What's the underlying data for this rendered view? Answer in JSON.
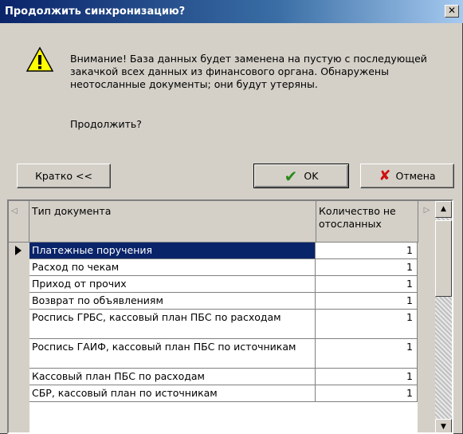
{
  "dialog": {
    "title": "Продолжить синхронизацию?",
    "close_glyph": "✕",
    "message": "Внимание! База данных будет заменена на пустую с последующей закачкой всех данных из финансового органа. Обнаружены неотосланные документы; они будут утеряны.",
    "question": "Продолжить?"
  },
  "buttons": {
    "short": "Кратко <<",
    "ok": "OK",
    "cancel": "Отмена"
  },
  "table": {
    "columns": [
      "Тип документа",
      "Количество не отосланных"
    ],
    "rows": [
      {
        "type": "Платежные поручения",
        "count": "1"
      },
      {
        "type": "Расход по чекам",
        "count": "1"
      },
      {
        "type": "Приход от прочих",
        "count": "1"
      },
      {
        "type": "Возврат по объявлениям",
        "count": "1"
      },
      {
        "type": "Роспись ГРБС, кассовый план ПБС по расходам",
        "count": "1"
      },
      {
        "type": "Роспись ГАИФ, кассовый план ПБС по источникам",
        "count": "1"
      },
      {
        "type": "Кассовый план ПБС по расходам",
        "count": "1"
      },
      {
        "type": "СБР, кассовый план по источникам",
        "count": "1"
      }
    ],
    "selected_index": 0
  },
  "icons": {
    "warning": "warning-icon",
    "ok": "check-icon",
    "cancel": "cross-icon",
    "row_pointer": "row-pointer-icon"
  },
  "colors": {
    "title_start": "#0a246a",
    "title_end": "#a6caf0",
    "selection": "#0a246a",
    "face": "#d4d0c8"
  }
}
